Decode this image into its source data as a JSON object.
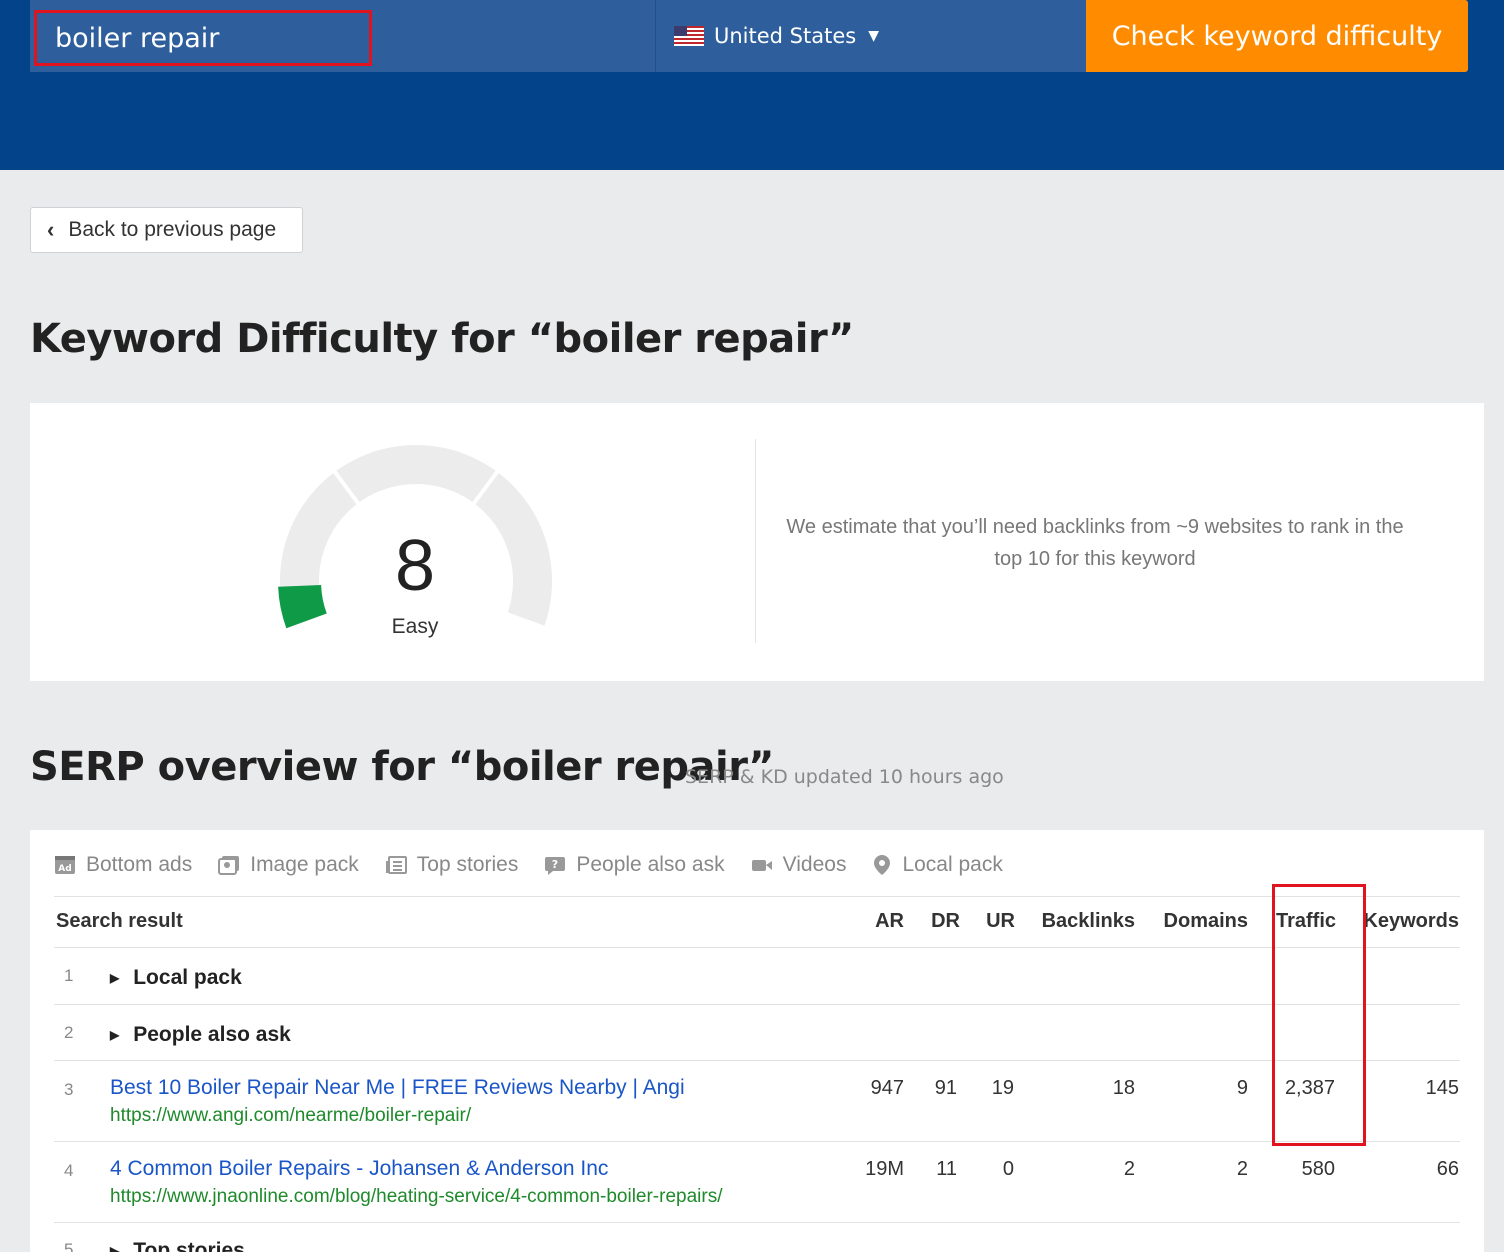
{
  "header": {
    "keyword_value": "boiler repair",
    "country": "United States",
    "check_button_label": "Check keyword difficulty",
    "colors": {
      "header_bg": "#02438a",
      "button": "#ff8c00",
      "highlight": "#e0141e"
    }
  },
  "back_label": "Back to previous page",
  "kd": {
    "title": "Keyword Difficulty for “boiler repair”",
    "score": "8",
    "score_fraction": 0.08,
    "level": "Easy",
    "estimate": "We estimate that you’ll need backlinks from ~9 websites to rank in the top 10 for this keyword"
  },
  "serp": {
    "title": "SERP overview for “boiler repair”",
    "updated": "SERP & KD updated 10 hours ago",
    "features": [
      {
        "label": "Bottom ads",
        "icon": "ad-icon"
      },
      {
        "label": "Image pack",
        "icon": "image-icon"
      },
      {
        "label": "Top stories",
        "icon": "newspaper-icon"
      },
      {
        "label": "People also ask",
        "icon": "question-icon"
      },
      {
        "label": "Videos",
        "icon": "video-camera-icon"
      },
      {
        "label": "Local pack",
        "icon": "map-pin-icon"
      }
    ],
    "columns": [
      "Search result",
      "AR",
      "DR",
      "UR",
      "Backlinks",
      "Domains",
      "Traffic",
      "Keywords"
    ],
    "rows": [
      {
        "num": "1",
        "label": "Local pack"
      },
      {
        "num": "2",
        "label": "People also ask"
      },
      {
        "num": "3",
        "title": "Best 10 Boiler Repair Near Me | FREE Reviews Nearby | Angi",
        "url": "https://www.angi.com/nearme/boiler-repair/",
        "ar": "947",
        "dr": "91",
        "ur": "19",
        "backlinks": "18",
        "domains": "9",
        "traffic": "2,387",
        "keywords": "145"
      },
      {
        "num": "4",
        "title": "4 Common Boiler Repairs - Johansen & Anderson Inc",
        "url": "https://www.jnaonline.com/blog/heating-service/4-common-boiler-repairs/",
        "ar": "19M",
        "dr": "11",
        "ur": "0",
        "backlinks": "2",
        "domains": "2",
        "traffic": "580",
        "keywords": "66"
      },
      {
        "num": "5",
        "label": "Top stories"
      }
    ]
  }
}
